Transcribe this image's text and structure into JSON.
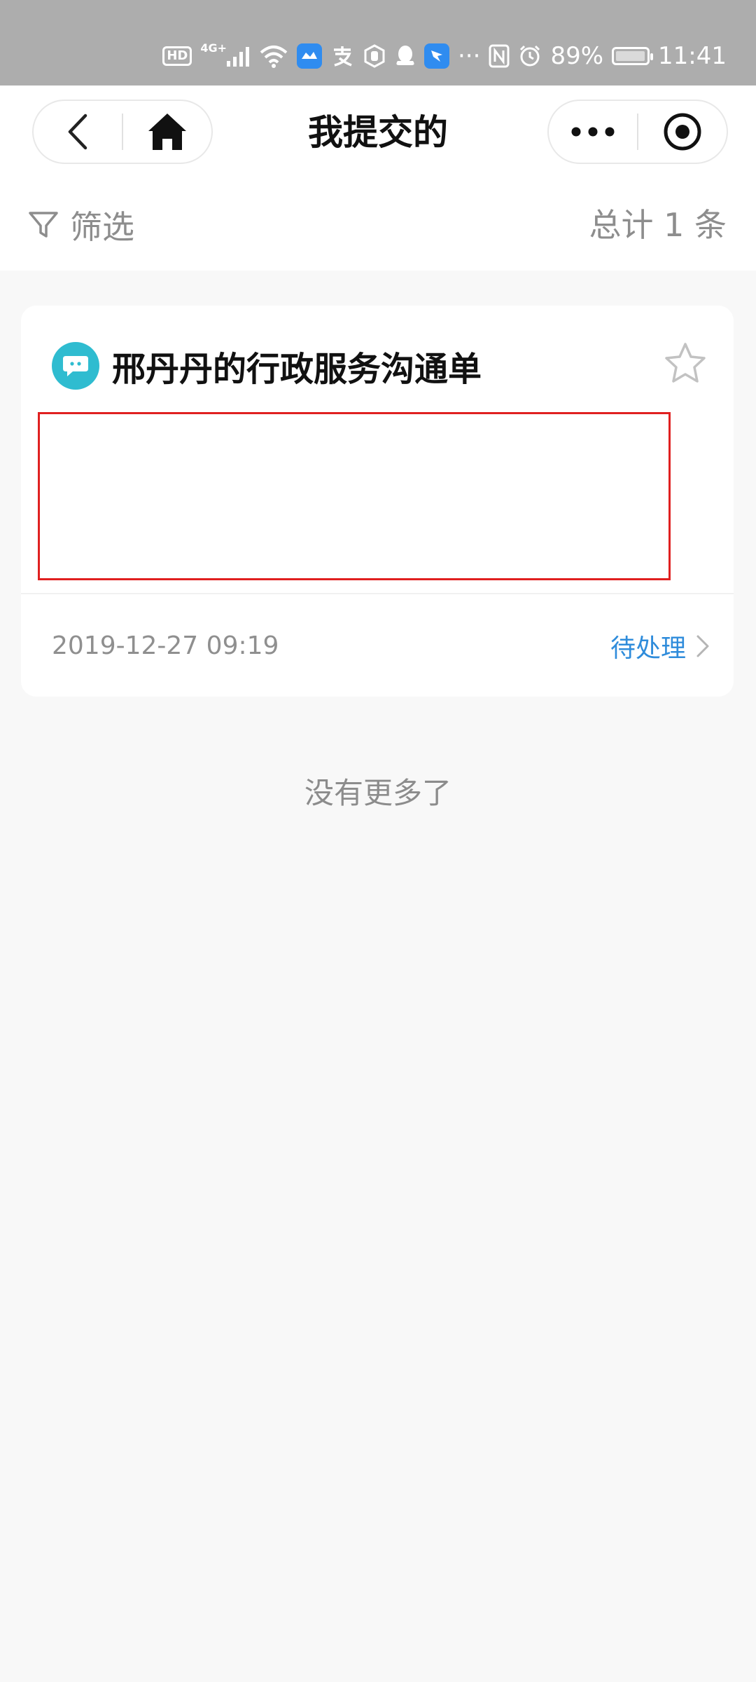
{
  "status_bar": {
    "hd": "HD",
    "network": "4G+",
    "dots": "···",
    "battery": "89%",
    "time": "11:41"
  },
  "nav": {
    "title": "我提交的"
  },
  "filter": {
    "label": "筛选",
    "total": "总计 1 条"
  },
  "card": {
    "title": "邢丹丹的行政服务沟通单",
    "time": "2019-12-27 09:19",
    "status": "待处理"
  },
  "footer": {
    "no_more": "没有更多了"
  },
  "colors": {
    "accent": "#2f8cdb",
    "icon_bg": "#2fbcd0",
    "redact_border": "#e02020"
  }
}
